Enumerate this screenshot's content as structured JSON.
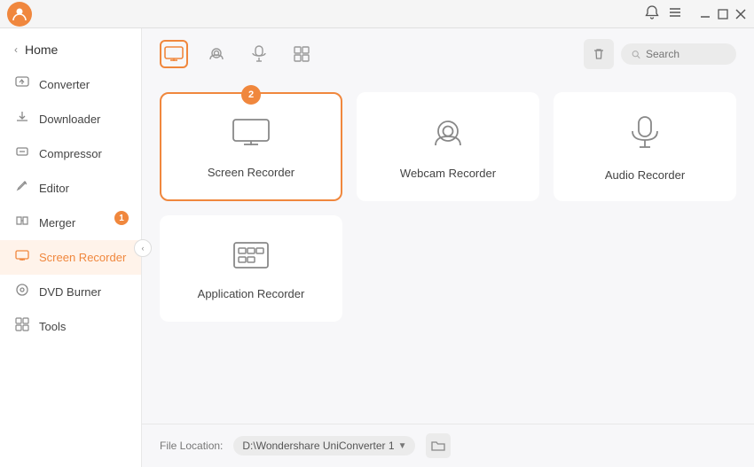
{
  "titlebar": {
    "user_avatar": "U",
    "bell_icon": "🔔",
    "menu_icon": "☰",
    "minimize_icon": "—",
    "maximize_icon": "□",
    "close_icon": "✕"
  },
  "sidebar": {
    "home_label": "Home",
    "back_icon": "‹",
    "items": [
      {
        "id": "converter",
        "label": "Converter",
        "icon": "⬡",
        "active": false,
        "badge": null
      },
      {
        "id": "downloader",
        "label": "Downloader",
        "icon": "⬇",
        "active": false,
        "badge": null
      },
      {
        "id": "compressor",
        "label": "Compressor",
        "icon": "◈",
        "active": false,
        "badge": null
      },
      {
        "id": "editor",
        "label": "Editor",
        "icon": "✂",
        "active": false,
        "badge": null
      },
      {
        "id": "merger",
        "label": "Merger",
        "icon": "⊞",
        "active": false,
        "badge": "1"
      },
      {
        "id": "screen-recorder",
        "label": "Screen Recorder",
        "icon": "⊟",
        "active": true,
        "badge": null
      },
      {
        "id": "dvd-burner",
        "label": "DVD Burner",
        "icon": "⊙",
        "active": false,
        "badge": null
      },
      {
        "id": "tools",
        "label": "Tools",
        "icon": "⊞",
        "active": false,
        "badge": null
      }
    ]
  },
  "toolbar": {
    "tabs": [
      {
        "id": "screen",
        "icon": "monitor",
        "active": true
      },
      {
        "id": "webcam",
        "icon": "webcam",
        "active": false
      },
      {
        "id": "audio",
        "icon": "mic",
        "active": false
      },
      {
        "id": "apps",
        "icon": "grid",
        "active": false
      }
    ],
    "search_placeholder": "Search",
    "trash_icon": "trash"
  },
  "recorders": {
    "cards": [
      {
        "id": "screen-recorder",
        "label": "Screen Recorder",
        "selected": true,
        "badge": "2"
      },
      {
        "id": "webcam-recorder",
        "label": "Webcam Recorder",
        "selected": false,
        "badge": null
      },
      {
        "id": "audio-recorder",
        "label": "Audio Recorder",
        "selected": false,
        "badge": null
      },
      {
        "id": "application-recorder",
        "label": "Application Recorder",
        "selected": false,
        "badge": null
      }
    ]
  },
  "bottombar": {
    "file_location_label": "File Location:",
    "file_path": "D:\\Wondershare UniConverter 1",
    "folder_icon": "folder"
  }
}
